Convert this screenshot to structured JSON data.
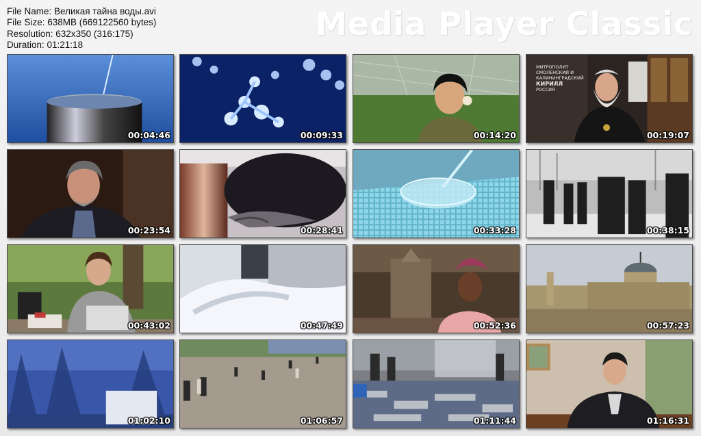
{
  "file_info": {
    "file_name": "File Name: Великая тайна воды.avi",
    "file_size": "File Size: 638MB (669122560 bytes)",
    "resolution": "Resolution: 632x350 (316:175)",
    "duration": "Duration: 01:21:18"
  },
  "brand": "Media Player Classic",
  "overlay_caption": {
    "line1": "Митрополит",
    "line2": "Смоленский и",
    "line3": "Калининградский",
    "name": "Кирилл",
    "country": "Россия"
  },
  "thumbnails": [
    {
      "time": "00:04:46",
      "scene": "water-drop-glass"
    },
    {
      "time": "00:09:33",
      "scene": "water-molecules"
    },
    {
      "time": "00:14:20",
      "scene": "woman-eating-greenhouse"
    },
    {
      "time": "00:19:07",
      "scene": "metropolitan-interview"
    },
    {
      "time": "00:23:54",
      "scene": "man-interview"
    },
    {
      "time": "00:28:41",
      "scene": "metal-cylinder"
    },
    {
      "time": "00:33:28",
      "scene": "petri-dish-pipette"
    },
    {
      "time": "00:38:15",
      "scene": "historic-street"
    },
    {
      "time": "00:43:02",
      "scene": "man-laptop-park"
    },
    {
      "time": "00:47:49",
      "scene": "lab-gloved-hands"
    },
    {
      "time": "00:52:36",
      "scene": "woman-shrine"
    },
    {
      "time": "00:57:23",
      "scene": "old-city-dome"
    },
    {
      "time": "01:02:10",
      "scene": "blue-forest"
    },
    {
      "time": "01:06:57",
      "scene": "square-crowd"
    },
    {
      "time": "01:11:44",
      "scene": "flood-debris"
    },
    {
      "time": "01:16:31",
      "scene": "man-office"
    }
  ]
}
